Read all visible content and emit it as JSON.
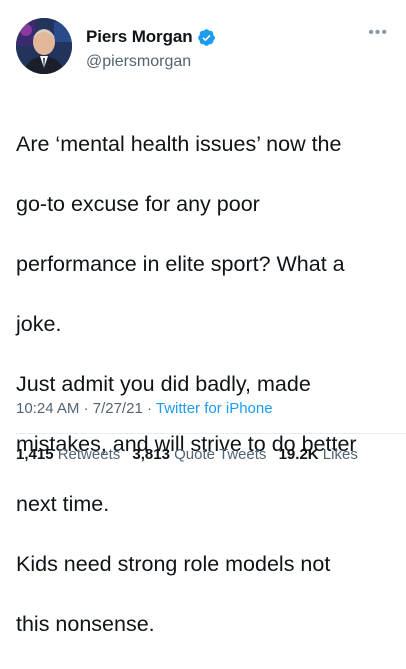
{
  "author": {
    "display_name": "Piers Morgan",
    "handle": "@piersmorgan",
    "verified_icon": "verified-badge-icon",
    "avatar_icon": "avatar-photo"
  },
  "more_icon": "more-options-icon",
  "tweet": {
    "lines": [
      "Are ‘mental health issues’ now the",
      "go-to excuse for any poor",
      "performance in elite sport? What a",
      "joke.",
      "Just admit you did badly, made",
      "mistakes, and will strive to do better",
      "next time.",
      "Kids need strong role models not",
      "this nonsense."
    ]
  },
  "meta": {
    "time": "10:24 AM",
    "separator": "·",
    "date": "7/27/21",
    "source": "Twitter for iPhone"
  },
  "stats": {
    "retweets_count": "1,415",
    "retweets_label": "Retweets",
    "quotes_count": "3,813",
    "quotes_label": "Quote Tweets",
    "likes_count": "19.2K",
    "likes_label": "Likes"
  },
  "colors": {
    "text": "#0f1419",
    "secondary": "#536471",
    "link": "#1d9bf0",
    "verified": "#1d9bf0"
  }
}
